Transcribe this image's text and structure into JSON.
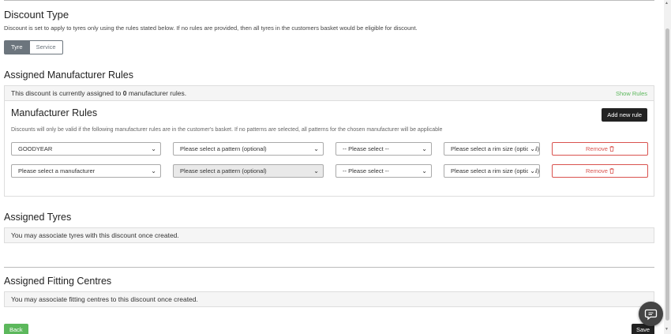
{
  "discount_type": {
    "heading": "Discount Type",
    "description": "Discount is set to apply to tyres only using the rules stated below. If no rules are provided, then all tyres in the customers basket would be eligible for discount.",
    "options": [
      {
        "label": "Tyre",
        "selected": true
      },
      {
        "label": "Service",
        "selected": false
      }
    ]
  },
  "manufacturer_section": {
    "heading": "Assigned Manufacturer Rules",
    "assigned_prefix": "This discount is currently assigned to ",
    "assigned_count": "0",
    "assigned_suffix": " manufacturer rules.",
    "show_rules": "Show Rules",
    "rules_heading": "Manufacturer Rules",
    "add_new_rule": "Add new rule",
    "note": "Discounts will only be valid if the following manufacturer rules are in the customer's basket. If no patterns are selected, all patterns for the chosen manufacturer will be applicable",
    "rules": [
      {
        "manufacturer": "GOODYEAR",
        "pattern": "Please select a pattern (optional)",
        "type": "-- Please select --",
        "rim_size": "Please select a rim size (optional)",
        "remove": "Remove",
        "pattern_disabled": false
      },
      {
        "manufacturer": "Please select a manufacturer",
        "pattern": "Please select a pattern (optional)",
        "type": "-- Please select --",
        "rim_size": "Please select a rim size (optional)",
        "remove": "Remove",
        "pattern_disabled": true
      }
    ]
  },
  "tyres_section": {
    "heading": "Assigned Tyres",
    "message": "You may associate tyres with this discount once created."
  },
  "fitting_section": {
    "heading": "Assigned Fitting Centres",
    "message": "You may associate fitting centres to this discount once created."
  },
  "footer": {
    "back": "Back",
    "save": "Save"
  },
  "colors": {
    "primary_dark": "#222222",
    "success": "#5cb85c",
    "danger": "#d9534f",
    "secondary": "#6c757d"
  },
  "icons": {
    "remove": "trash-icon",
    "chat": "chat-bubble-icon"
  }
}
